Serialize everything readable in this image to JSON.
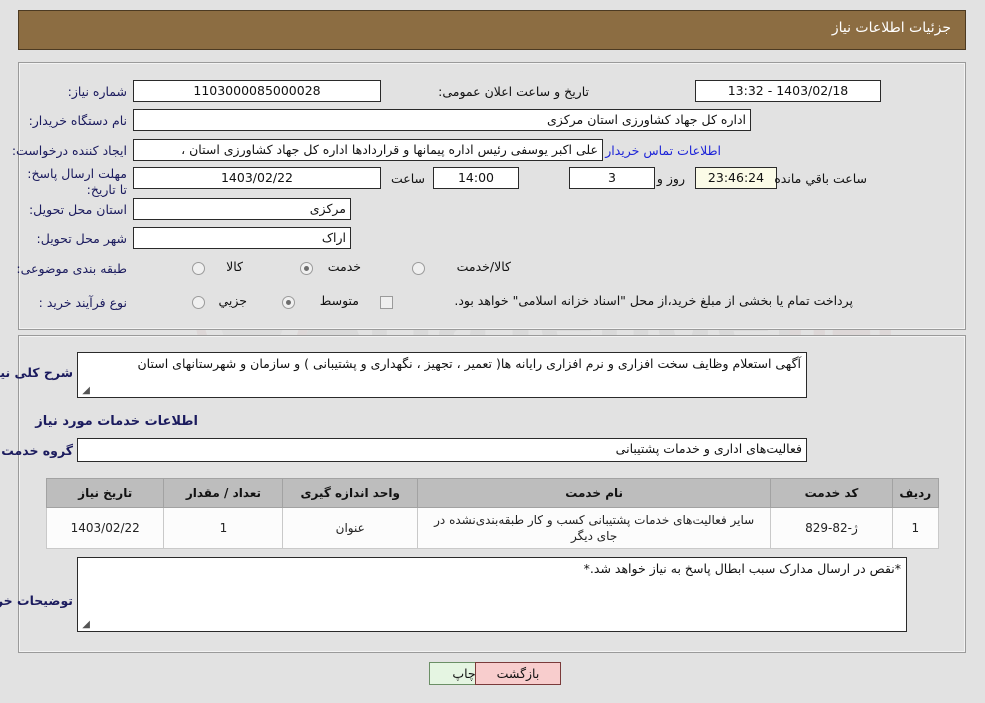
{
  "window": {
    "title": "جزئیات اطلاعات نیاز",
    "header_color": "#8c6d42"
  },
  "top_form": {
    "need_number": {
      "label": "شماره نیاز:",
      "value": "1103000085000028"
    },
    "public_announcement": {
      "label": "تاریخ و ساعت اعلان عمومی:",
      "value": "1403/02/18 - 13:32"
    },
    "buyer_org": {
      "label": "نام دستگاه خریدار:",
      "value": "اداره کل جهاد کشاورزی استان مرکزی"
    },
    "requester": {
      "label": "ایجاد کننده درخواست:",
      "value": "علی اکبر یوسفی رئیس اداره پیمانها و قراردادها اداره کل جهاد کشاورزی استان ،",
      "contact_link": "اطلاعات تماس خریدار"
    },
    "deadline": {
      "label": "مهلت ارسال پاسخ: تا تاریخ:",
      "date": "1403/02/22",
      "time_label": "ساعت",
      "time": "14:00",
      "days": "3",
      "days_suffix": "روز و",
      "countdown": "23:46:24",
      "countdown_suffix": "ساعت باقي مانده"
    },
    "delivery_province": {
      "label": "استان محل تحویل:",
      "value": "مرکزی"
    },
    "delivery_city": {
      "label": "شهر محل تحویل:",
      "value": "اراک"
    },
    "subject_classification": {
      "label": "طبقه بندی موضوعی:",
      "options": [
        {
          "label": "کالا",
          "selected": false
        },
        {
          "label": "خدمت",
          "selected": true
        },
        {
          "label": "کالا/خدمت",
          "selected": false
        }
      ]
    },
    "purchase_process": {
      "label": "نوع فرآیند خرید :",
      "options": [
        {
          "label": "جزیي",
          "selected": false
        },
        {
          "label": "متوسط",
          "selected": true
        }
      ],
      "treasury_checkbox": {
        "checked": false,
        "label": "پرداخت تمام یا بخشی از مبلغ خرید،از محل \"اسناد خزانه اسلامی\" خواهد بود."
      }
    }
  },
  "main": {
    "general_description": {
      "label": "شرح کلی نیاز:",
      "value": "آگهی استعلام وظایف سخت افزاری و نرم افزاری رایانه ها( تعمیر ، تجهیز ، نگهداری و پشتیبانی ) و سازمان و شهرستانهای استان"
    },
    "services_section_title": "اطلاعات خدمات مورد نیاز",
    "service_group": {
      "label": "گروه خدمت:",
      "value": "فعالیت‌های اداری و خدمات پشتیبانی"
    },
    "table": {
      "headers": [
        "ردیف",
        "کد خدمت",
        "نام خدمت",
        "واحد اندازه گیری",
        "تعداد / مقدار",
        "تاریخ نیاز"
      ],
      "rows": [
        {
          "row": "1",
          "code": "ژ-82-829",
          "name": "سایر فعالیت‌های خدمات پشتیبانی کسب و کار طبقه‌بندی‌نشده در جای دیگر",
          "unit": "عنوان",
          "qty": "1",
          "date": "1403/02/22"
        }
      ]
    },
    "buyer_notes": {
      "label": "توضیحات خریدار:",
      "value": "*نقص در ارسال مدارک سبب ابطال پاسخ به نیاز خواهد شد.*"
    }
  },
  "footer": {
    "print_button": "چاپ",
    "back_button": "بازگشت"
  },
  "watermark": {
    "text": "AriaTender.net"
  }
}
